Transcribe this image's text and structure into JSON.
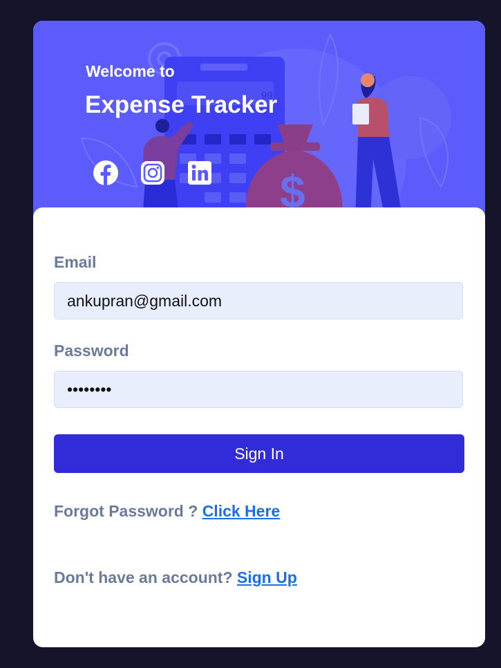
{
  "header": {
    "welcome_text": "Welcome to",
    "app_title": "Expense Tracker",
    "calculator_display": "99",
    "currency_symbol": "$"
  },
  "social": [
    {
      "icon": "facebook-icon"
    },
    {
      "icon": "instagram-icon"
    },
    {
      "icon": "linkedin-icon"
    }
  ],
  "form": {
    "email_label": "Email",
    "email_value": "ankupran@gmail.com",
    "password_label": "Password",
    "password_value": "12345678",
    "sign_in_label": "Sign In",
    "forgot_text": "Forgot Password ? ",
    "forgot_link": "Click Here",
    "signup_text": "Don't have an account? ",
    "signup_link": "Sign Up"
  },
  "colors": {
    "page_background": "#15142a",
    "hero_background": "#5b5cfb",
    "button": "#312bd9",
    "input_background": "#e8eefb",
    "label": "#6b7a99",
    "link": "#1a6fe8"
  }
}
